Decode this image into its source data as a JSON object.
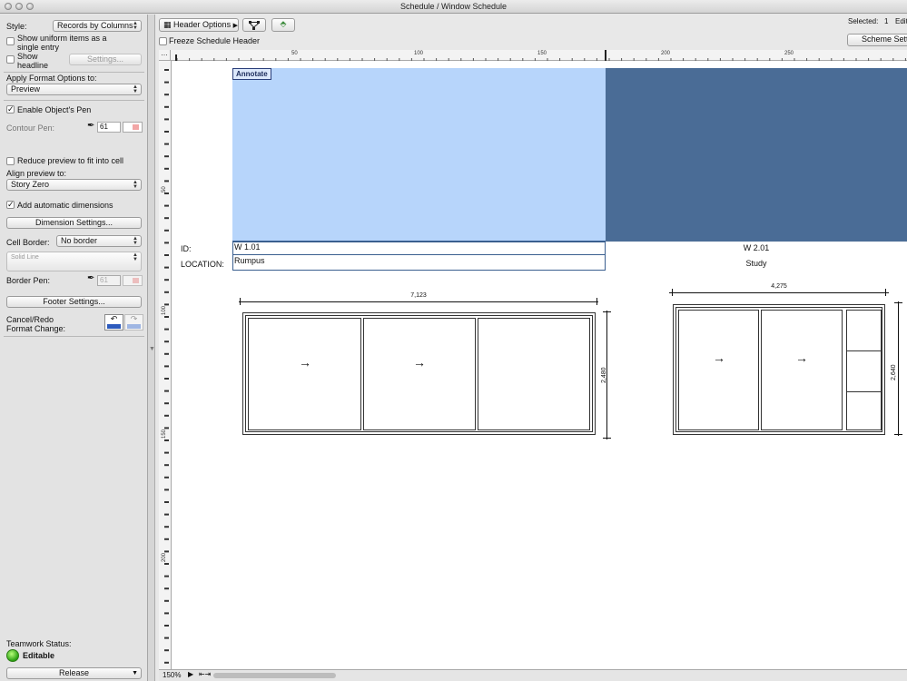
{
  "window": {
    "title": "Schedule /  Window Schedule"
  },
  "sidebar": {
    "style_label": "Style:",
    "style_value": "Records by Columns",
    "show_uniform_label_1": "Show uniform items as a",
    "show_uniform_label_2": "single entry",
    "show_headline_label_1": "Show",
    "show_headline_label_2": "headline",
    "settings_button": "Settings...",
    "apply_format_label": "Apply Format Options to:",
    "apply_format_value": "Preview",
    "enable_pen_label": "Enable Object's Pen",
    "contour_pen_label": "Contour Pen:",
    "contour_pen_value": "61",
    "reduce_preview_label": "Reduce preview to fit into cell",
    "align_preview_label": "Align preview to:",
    "align_preview_value": "Story Zero",
    "add_dimensions_label": "Add automatic dimensions",
    "dimension_settings_button": "Dimension Settings...",
    "cell_border_label": "Cell Border:",
    "cell_border_value": "No border",
    "line_type_value": "Solid Line",
    "border_pen_label": "Border Pen:",
    "border_pen_value": "61",
    "footer_settings_button": "Footer Settings...",
    "cancel_redo_label_1": "Cancel/Redo",
    "cancel_redo_label_2": "Format Change:",
    "teamwork_status_label": "Teamwork Status:",
    "teamwork_status_value": "Editable",
    "release_button": "Release"
  },
  "toolbar": {
    "header_options": "Header Options",
    "freeze_header_label": "Freeze Schedule Header",
    "selected_label": "Selected:",
    "selected_count": "1",
    "edit_label": "Edit",
    "scheme_settings": "Scheme Setti"
  },
  "ruler": {
    "h_labels": [
      "50",
      "100",
      "150",
      "200",
      "250"
    ],
    "v_labels": [
      "50",
      "100",
      "150",
      "200"
    ]
  },
  "schedule": {
    "annotate_tag": "Annotate",
    "row_labels": [
      "ID:",
      "LOCATION:"
    ],
    "items": [
      {
        "id": "W 1.01",
        "location": "Rumpus",
        "width_dim": "7,123",
        "height_dim": "2,480"
      },
      {
        "id": "W 2.01",
        "location": "Study",
        "width_dim": "4,275",
        "height_dim": "2,640"
      }
    ]
  },
  "status": {
    "zoom": "150%"
  },
  "colors": {
    "selected_cell": "#b7d5fb",
    "header_cell": "#4a6c96",
    "accent_green": "#2aa012"
  }
}
